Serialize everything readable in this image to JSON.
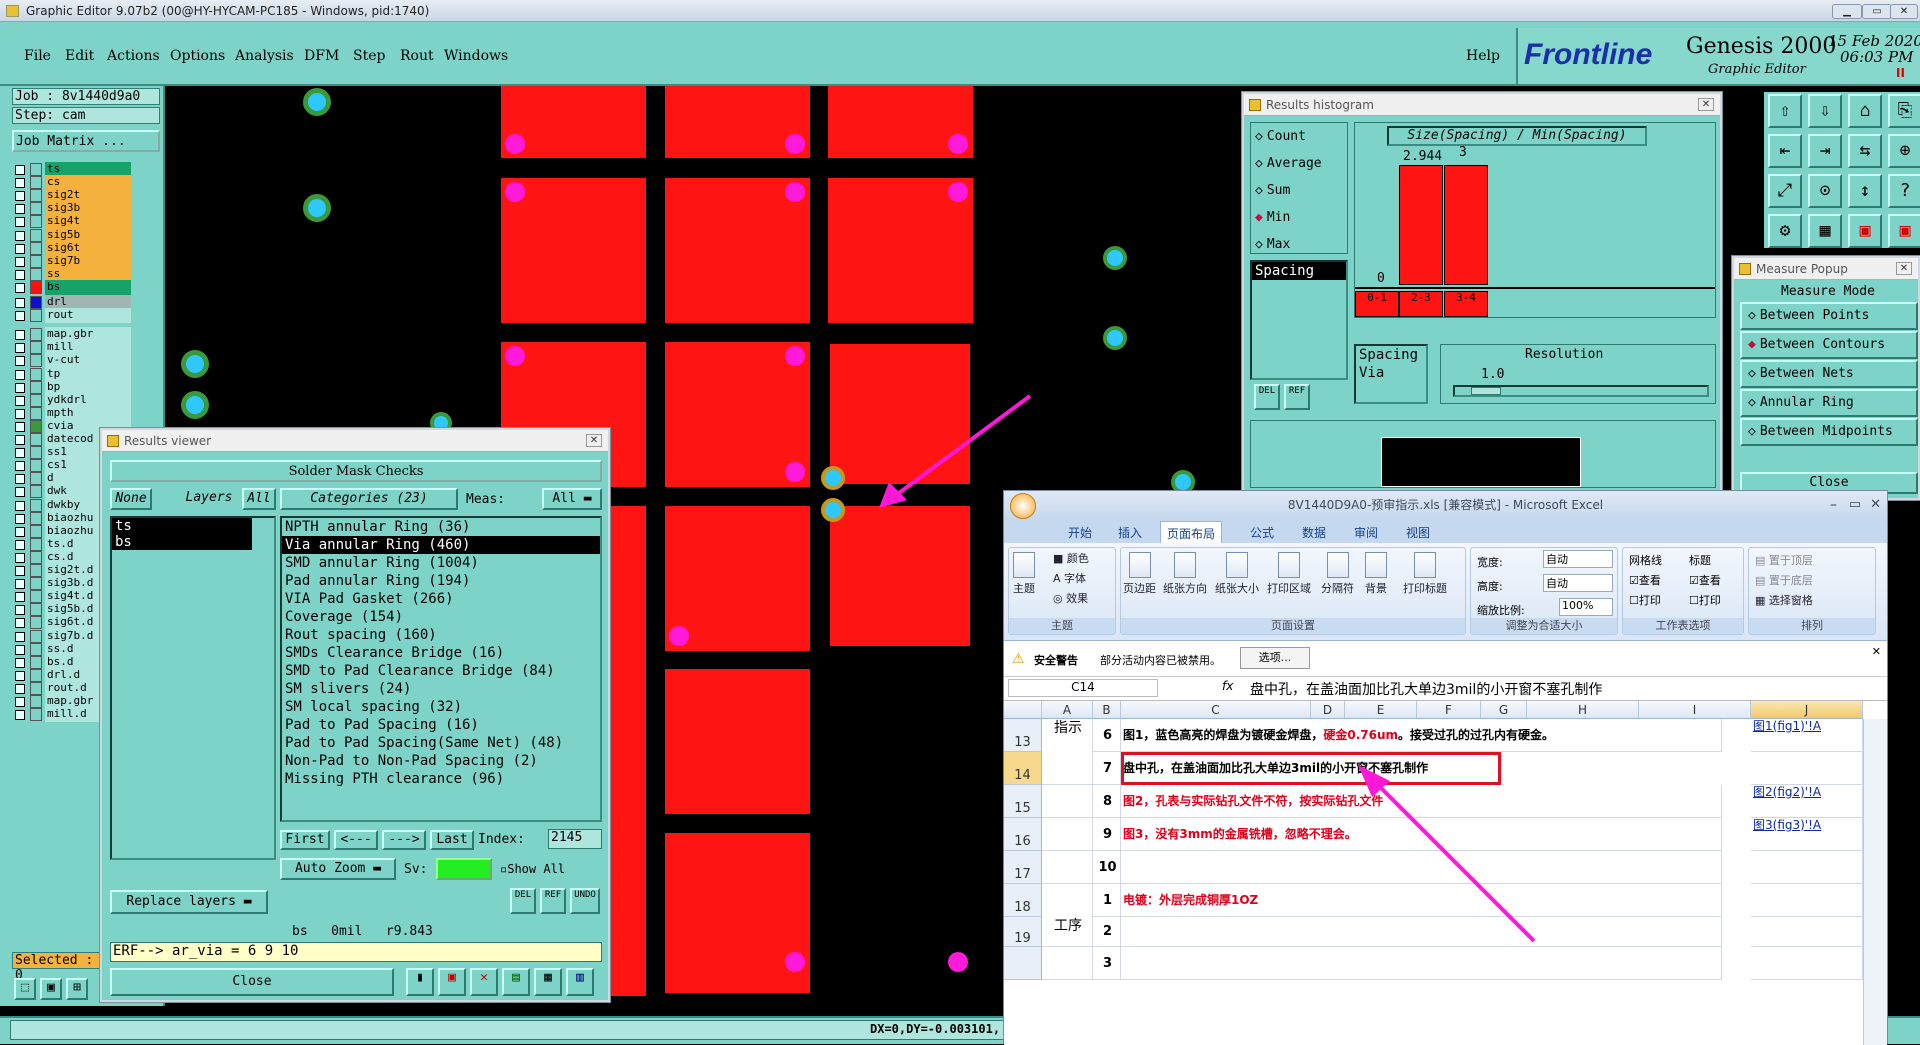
{
  "window": {
    "title": "Graphic Editor 9.07b2 (00@HY-HYCAM-PC185 - Windows, pid:1740)"
  },
  "menu": {
    "items": [
      "File",
      "Edit",
      "Actions",
      "Options",
      "Analysis",
      "DFM",
      "Step",
      "Rout",
      "Windows"
    ],
    "help": "Help"
  },
  "brand": {
    "logo": "Frontline",
    "product": "Genesis 2000",
    "sub": "Graphic Editor",
    "date": "15 Feb 2020",
    "time": "06:03 PM",
    "marker": "II"
  },
  "job": {
    "job_label": "Job : 8v1440d9a0",
    "step_label": "Step: cam",
    "matrix_btn": "Job Matrix ..."
  },
  "layers": [
    {
      "name": "ts",
      "color": "#16a36a"
    },
    {
      "name": "cs",
      "color": "#f5b13d"
    },
    {
      "name": "sig2t",
      "color": "#f5b13d"
    },
    {
      "name": "sig3b",
      "color": "#f5b13d"
    },
    {
      "name": "sig4t",
      "color": "#f5b13d"
    },
    {
      "name": "sig5b",
      "color": "#f5b13d"
    },
    {
      "name": "sig6t",
      "color": "#f5b13d"
    },
    {
      "name": "sig7b",
      "color": "#f5b13d"
    },
    {
      "name": "ss",
      "color": "#f5b13d"
    },
    {
      "name": "bs",
      "color": "#16a36a",
      "swatch": "#ff1010"
    },
    {
      "name": "drl",
      "color": "#9fb6b2",
      "swatch": "#1010cc"
    },
    {
      "name": "rout",
      "color": "#aee6de"
    },
    {
      "name": "map.gbr",
      "color": "#aee6de"
    },
    {
      "name": "mill",
      "color": "#aee6de"
    },
    {
      "name": "v-cut",
      "color": "#aee6de"
    },
    {
      "name": "tp",
      "color": "#aee6de"
    },
    {
      "name": "bp",
      "color": "#aee6de"
    },
    {
      "name": "ydkdrl",
      "color": "#aee6de"
    },
    {
      "name": "mpth",
      "color": "#aee6de"
    },
    {
      "name": "cvia",
      "color": "#aee6de",
      "swatch": "#3a9a3a"
    },
    {
      "name": "datecod",
      "color": "#aee6de"
    },
    {
      "name": "ss1",
      "color": "#aee6de"
    },
    {
      "name": "cs1",
      "color": "#aee6de"
    },
    {
      "name": "d",
      "color": "#aee6de"
    },
    {
      "name": "dwk",
      "color": "#aee6de"
    },
    {
      "name": "dwkby",
      "color": "#aee6de"
    },
    {
      "name": "biaozhu",
      "color": "#aee6de"
    },
    {
      "name": "biaozhu",
      "color": "#aee6de"
    },
    {
      "name": "ts.d",
      "color": "#aee6de"
    },
    {
      "name": "cs.d",
      "color": "#aee6de"
    },
    {
      "name": "sig2t.d",
      "color": "#aee6de"
    },
    {
      "name": "sig3b.d",
      "color": "#aee6de"
    },
    {
      "name": "sig4t.d",
      "color": "#aee6de"
    },
    {
      "name": "sig5b.d",
      "color": "#aee6de"
    },
    {
      "name": "sig6t.d",
      "color": "#aee6de"
    },
    {
      "name": "sig7b.d",
      "color": "#aee6de"
    },
    {
      "name": "ss.d",
      "color": "#aee6de"
    },
    {
      "name": "bs.d",
      "color": "#aee6de"
    },
    {
      "name": "drl.d",
      "color": "#aee6de"
    },
    {
      "name": "rout.d",
      "color": "#aee6de"
    },
    {
      "name": "map.gbr",
      "color": "#aee6de"
    },
    {
      "name": "mill.d",
      "color": "#aee6de"
    }
  ],
  "selected": "Selected : 0",
  "status": {
    "coords": "DX=0,DY=-0.003101,"
  },
  "results_viewer": {
    "title": "Results viewer",
    "header": "Solder Mask Checks",
    "none": "None",
    "layers": "Layers",
    "all": "All",
    "layer_list": [
      "ts",
      "bs"
    ],
    "categories_label": "Categories (23)",
    "meas_label": "Meas:",
    "meas_value": "All",
    "categories": [
      "NPTH annular Ring (36)",
      "Via annular Ring (460)",
      "SMD annular Ring (1004)",
      "Pad annular Ring (194)",
      "VIA Pad Gasket (266)",
      "Coverage (154)",
      "Rout spacing (160)",
      "SMDs Clearance Bridge (16)",
      "SMD to Pad Clearance Bridge (84)",
      "SM slivers (24)",
      "SM local spacing (32)",
      "Pad to Pad Spacing (16)",
      "Pad to Pad Spacing(Same Net) (48)",
      "Non-Pad to Non-Pad Spacing (2)",
      "Missing PTH clearance (96)"
    ],
    "first": "First",
    "prev": "<---",
    "next": "--->",
    "last": "Last",
    "index_label": "Index:",
    "index_value": "2145",
    "autozoom": "Auto Zoom",
    "sv": "Sv:",
    "showall": "Show All",
    "replace": "Replace layers",
    "del": "DEL",
    "ref": "REF",
    "undo": "UNDO",
    "info": "bs   0mil   r9.843",
    "erf": "ERF--> ar_via = 6 9 10",
    "close": "Close"
  },
  "histogram": {
    "title": "Results histogram",
    "options": [
      "Count",
      "Average",
      "Sum",
      "Min",
      "Max"
    ],
    "selected": "Min",
    "chart_title": "Size(Spacing) / Min(Spacing)",
    "bar_labels": [
      "2.944",
      "3"
    ],
    "zero": "0",
    "bins": [
      "0-1",
      "2-3",
      "3-4"
    ],
    "list": [
      "Spacing"
    ],
    "res_list": [
      "Spacing",
      "Via"
    ],
    "resolution_label": "Resolution",
    "resolution_value": "1.0",
    "del": "DEL",
    "ref": "REF"
  },
  "measure": {
    "title": "Measure Popup",
    "mode": "Measure Mode",
    "options": [
      "Between Points",
      "Between Contours",
      "Between Nets",
      "Annular Ring",
      "Between Midpoints"
    ],
    "close": "Close"
  },
  "excel": {
    "title": "8V1440D9A0-预审指示.xls  [兼容模式] - Microsoft Excel",
    "tabs": [
      "开始",
      "插入",
      "页面布局",
      "公式",
      "数据",
      "审阅",
      "视图"
    ],
    "ribbon": {
      "theme": "主题",
      "colors": "颜色",
      "fonts": "字体",
      "effects": "效果",
      "margins": "页边距",
      "orient": "纸张方向",
      "size": "纸张大小",
      "area": "打印区域",
      "breaks": "分隔符",
      "bg": "背景",
      "titles": "打印标题",
      "pagesetup": "页面设置",
      "width": "宽度:",
      "height": "高度:",
      "scale": "缩放比例:",
      "auto": "自动",
      "pct": "100%",
      "fit": "调整为合适大小",
      "gridlines": "网格线",
      "headings": "标题",
      "view": "查看",
      "print": "打印",
      "sheetopts": "工作表选项",
      "front": "置于顶层",
      "back": "置于底层",
      "pane": "选择窗格",
      "arrange": "排列"
    },
    "security": "安全警告",
    "security_msg": "部分活动内容已被禁用。",
    "options_btn": "选项...",
    "cellref": "C14",
    "fx": "fx",
    "formula": "盘中孔，在盖油面加比孔大单边3mil的小开窗不塞孔制作",
    "cols": [
      "A",
      "B",
      "C",
      "D",
      "E",
      "F",
      "G",
      "H",
      "I",
      "J"
    ],
    "rows": [
      {
        "r": "13",
        "a": "指示",
        "b": "6",
        "c": "图1，蓝色高亮的焊盘为镀硬金焊盘，",
        "c2": "硬金0.76um",
        "c3": "。接受过孔的过孔内有硬金。",
        "j": "图1(fig1)'!A"
      },
      {
        "r": "14",
        "a": "",
        "b": "7",
        "c": "盘中孔，在盖油面加比孔大单边3mil的小开窗不塞孔制作",
        "j": ""
      },
      {
        "r": "15",
        "a": "",
        "b": "8",
        "c": "图2，孔表与实际钻孔文件不符，按实际钻孔文件",
        "j": "图2(fig2)'!A"
      },
      {
        "r": "16",
        "a": "",
        "b": "9",
        "c": "图3，没有3mm的金属铣槽，忽略不理会。",
        "j": "图3(fig3)'!A"
      },
      {
        "r": "17",
        "a": "",
        "b": "10",
        "c": "",
        "j": ""
      },
      {
        "r": "18",
        "a": "",
        "b": "1",
        "c": "电镀：外层完成铜厚1OZ",
        "j": ""
      },
      {
        "r": "19",
        "a": "工序",
        "b": "2",
        "c": "",
        "j": ""
      },
      {
        "r": "",
        "a": "",
        "b": "3",
        "c": "",
        "j": ""
      }
    ]
  }
}
